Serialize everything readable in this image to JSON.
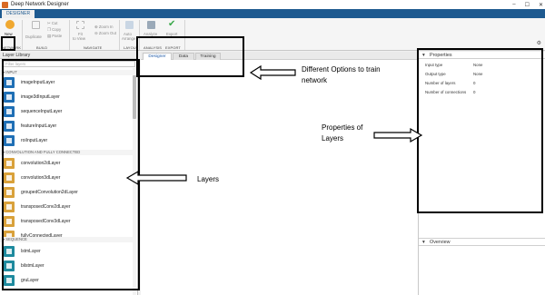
{
  "window": {
    "title": "Deep Network Designer"
  },
  "ribbon": {
    "tab": "DESIGNER",
    "buttons": {
      "new": "New",
      "duplicate": "Duplicate",
      "cut": "Cut",
      "copy": "Copy",
      "paste": "Paste",
      "fit_line1": "Fit",
      "fit_line2": "to View",
      "zoom_in": "Zoom In",
      "zoom_out": "Zoom Out",
      "auto_line1": "Auto",
      "auto_line2": "Arrange",
      "analyze": "Analyze",
      "export": "Export"
    },
    "sections": {
      "network": "NETWORK",
      "build": "BUILD",
      "navigate": "NAVIGATE",
      "layout": "LAYOUT",
      "analysis": "ANALYSIS",
      "export": "EXPORT"
    }
  },
  "layer_library": {
    "title": "Layer Library",
    "filter_placeholder": "Filter layers",
    "sections": [
      {
        "name": "INPUT",
        "items": [
          "imageInputLayer",
          "image3dInputLayer",
          "sequenceInputLayer",
          "featureInputLayer",
          "roiInputLayer"
        ]
      },
      {
        "name": "CONVOLUTION AND FULLY CONNECTED",
        "items": [
          "convolution2dLayer",
          "convolution3dLayer",
          "groupedConvolution2dLayer",
          "transposedConv2dLayer",
          "transposedConv3dLayer",
          "fullyConnectedLayer"
        ]
      },
      {
        "name": "SEQUENCE",
        "items": [
          "lstmLayer",
          "bilstmLayer",
          "gruLayer"
        ]
      }
    ]
  },
  "canvas_tabs": [
    "Designer",
    "Data",
    "Training"
  ],
  "properties": {
    "title": "Properties",
    "rows": [
      {
        "label": "Input type",
        "value": "None"
      },
      {
        "label": "Output type",
        "value": "None"
      },
      {
        "label": "Number of layers",
        "value": "0"
      },
      {
        "label": "Number of connections",
        "value": "0"
      }
    ]
  },
  "overview": {
    "title": "Overview"
  },
  "annotations": {
    "options_line1": "Different Options to train",
    "options_line2": "network",
    "properties_line1": "Properties of",
    "properties_line2": "Layers",
    "layers": "Layers"
  },
  "colors": {
    "ribbon_blue": "#1e5a90",
    "input_icon": "#1f6fb5",
    "conv_icon": "#d9a13a",
    "sequence_icon": "#1e8a9e",
    "new_icon": "#f0a830"
  },
  "icons": {
    "new": "plus-icon",
    "gear": "gear-icon",
    "collapse": "triangle-icon"
  }
}
